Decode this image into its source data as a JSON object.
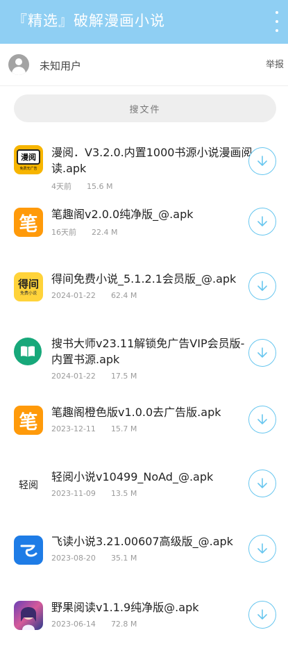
{
  "header": {
    "title": "『精选』破解漫画小说",
    "background_color": "#8fcff3",
    "menu_icon": "more-vert-icon"
  },
  "user": {
    "name": "未知用户",
    "avatar_icon": "user-avatar-icon",
    "report_label": "举报"
  },
  "search": {
    "label": "搜文件"
  },
  "accent_color": "#67c6ef",
  "files": [
    {
      "title": "漫阅．V3.2.0.内置1000书源小说漫画阅读.apk",
      "date": "4天前",
      "size": "15.6 M",
      "icon": "manyue-app-icon"
    },
    {
      "title": "笔趣阁v2.0.0纯净版_@.apk",
      "date": "16天前",
      "size": "22.4 M",
      "icon": "biquge-app-icon"
    },
    {
      "title": "得间免费小说_5.1.2.1会员版_@.apk",
      "date": "2024-01-22",
      "size": "62.4 M",
      "icon": "dejian-app-icon"
    },
    {
      "title": "搜书大师v23.11解锁免广告VIP会员版-内置书源.apk",
      "date": "2024-01-22",
      "size": "17.5 M",
      "icon": "book-app-icon"
    },
    {
      "title": "笔趣阁橙色版v1.0.0去广告版.apk",
      "date": "2023-12-11",
      "size": "15.7 M",
      "icon": "biquge-app-icon"
    },
    {
      "title": "轻阅小说v10499_NoAd_@.apk",
      "date": "2023-11-09",
      "size": "13.5 M",
      "icon": "qingyue-app-icon"
    },
    {
      "title": "飞读小说3.21.00607高级版_@.apk",
      "date": "2023-08-20",
      "size": "35.1 M",
      "icon": "feidu-app-icon"
    },
    {
      "title": "野果阅读v1.1.9纯净版@.apk",
      "date": "2023-06-14",
      "size": "72.8 M",
      "icon": "yeguo-app-icon"
    }
  ],
  "app_icon_text": {
    "manyue": "漫阅",
    "manyue_sub": "免费无广告",
    "biquge": "笔",
    "dejian": "得间",
    "dejian_sub": "免费小说",
    "qingyue": "轻阅"
  }
}
